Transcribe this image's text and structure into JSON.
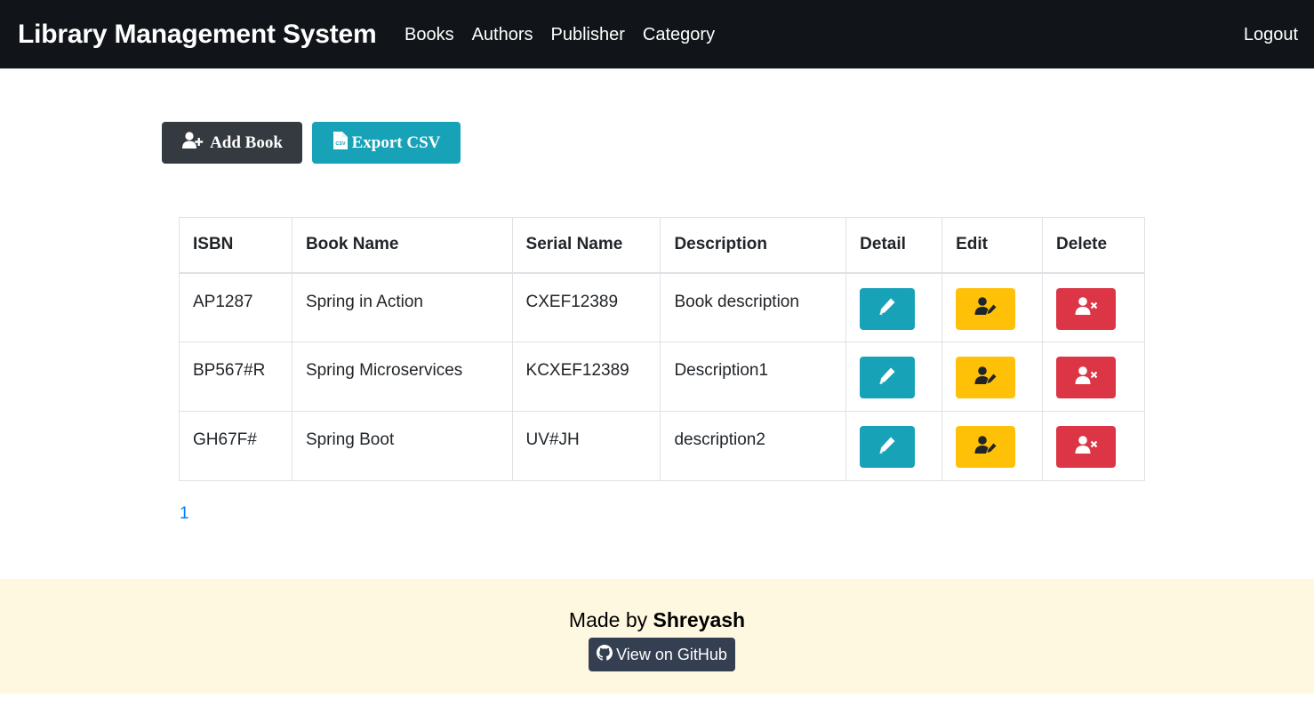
{
  "navbar": {
    "brand": "Library Management System",
    "links": [
      "Books",
      "Authors",
      "Publisher",
      "Category"
    ],
    "logout": "Logout"
  },
  "actions": {
    "add_book": "Add Book",
    "export_csv": "Export CSV",
    "csv_icon_text": "CSV"
  },
  "table": {
    "headers": [
      "ISBN",
      "Book Name",
      "Serial Name",
      "Description",
      "Detail",
      "Edit",
      "Delete"
    ],
    "rows": [
      {
        "isbn": "AP1287",
        "name": "Spring in Action",
        "serial": "CXEF12389",
        "description": "Book description"
      },
      {
        "isbn": "BP567#R",
        "name": "Spring Microservices",
        "serial": "KCXEF12389",
        "description": "Description1"
      },
      {
        "isbn": "GH67F#",
        "name": "Spring Boot",
        "serial": "UV#JH",
        "description": "description2"
      }
    ]
  },
  "pagination": {
    "current": "1"
  },
  "footer": {
    "made_by_prefix": "Made by",
    "author": "Shreyash",
    "github_label": "View on GitHub"
  },
  "colors": {
    "navbar_bg": "#111418",
    "add_button": "#343a40",
    "export_button": "#17a2b8",
    "detail_button": "#17a2b8",
    "edit_button": "#ffc107",
    "delete_button": "#dc3545",
    "footer_bg": "#fff8e0",
    "github_button": "#343f52",
    "link": "#007bff"
  },
  "icons": {
    "add_book": "user-plus-icon",
    "export_csv": "csv-file-icon",
    "detail": "pen-icon",
    "edit": "user-edit-icon",
    "delete": "user-times-icon",
    "github": "github-icon"
  }
}
